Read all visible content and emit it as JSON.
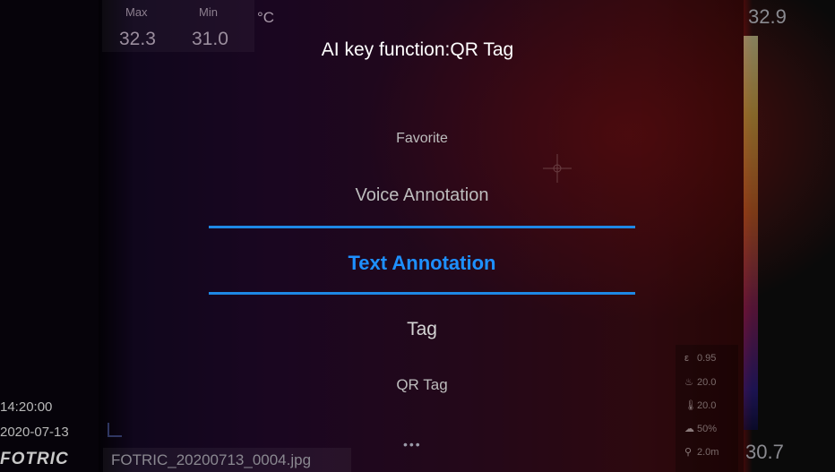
{
  "dialog": {
    "title": "AI key function:QR Tag",
    "items": [
      {
        "label": "Favorite"
      },
      {
        "label": "Voice Annotation"
      },
      {
        "label": "Text Annotation",
        "selected": true
      },
      {
        "label": "Tag"
      },
      {
        "label": "QR Tag"
      }
    ],
    "more": "•••",
    "accent_color": "#1e88e5"
  },
  "measurement": {
    "max_label": "Max",
    "min_label": "Min",
    "max_value": "32.3",
    "min_value": "31.0",
    "unit": "°C"
  },
  "scale": {
    "max": "32.9",
    "min": "30.7"
  },
  "parameters": [
    {
      "icon": "emissivity-icon",
      "value": "0.95"
    },
    {
      "icon": "reflected-temp-icon",
      "value": "20.0"
    },
    {
      "icon": "ambient-temp-icon",
      "value": "20.0"
    },
    {
      "icon": "humidity-icon",
      "value": "50%"
    },
    {
      "icon": "distance-icon",
      "value": "2.0m"
    }
  ],
  "image_info": {
    "time": "14:20:00",
    "date": "2020-07-13",
    "logo": "FOTRIC",
    "filename": "FOTRIC_20200713_0004.jpg"
  }
}
